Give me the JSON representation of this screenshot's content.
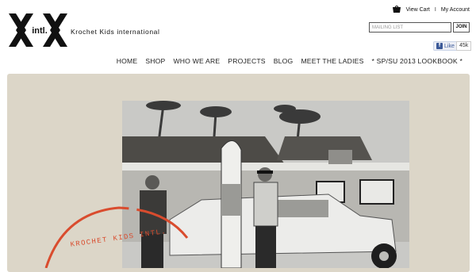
{
  "brand": {
    "logo_text": "intl.",
    "name": "Krochet Kids international"
  },
  "top_links": {
    "cart": "View Cart",
    "separator": "I",
    "account": "My Account"
  },
  "mailing": {
    "placeholder": "MAILING LIST",
    "join_label": "JOIN"
  },
  "facebook": {
    "like_label": "Like",
    "count": "45k"
  },
  "nav": {
    "items": [
      "HOME",
      "SHOP",
      "WHO WE ARE",
      "PROJECTS",
      "BLOG",
      "MEET THE LADIES",
      "* SP/SU 2013 LOOKBOOK *"
    ]
  },
  "hero": {
    "stamp_text": "KROCHET KIDS INTL."
  },
  "colors": {
    "accent": "#d94c2e",
    "hero_bg": "#dcd6c8",
    "facebook_blue": "#3b5998"
  }
}
